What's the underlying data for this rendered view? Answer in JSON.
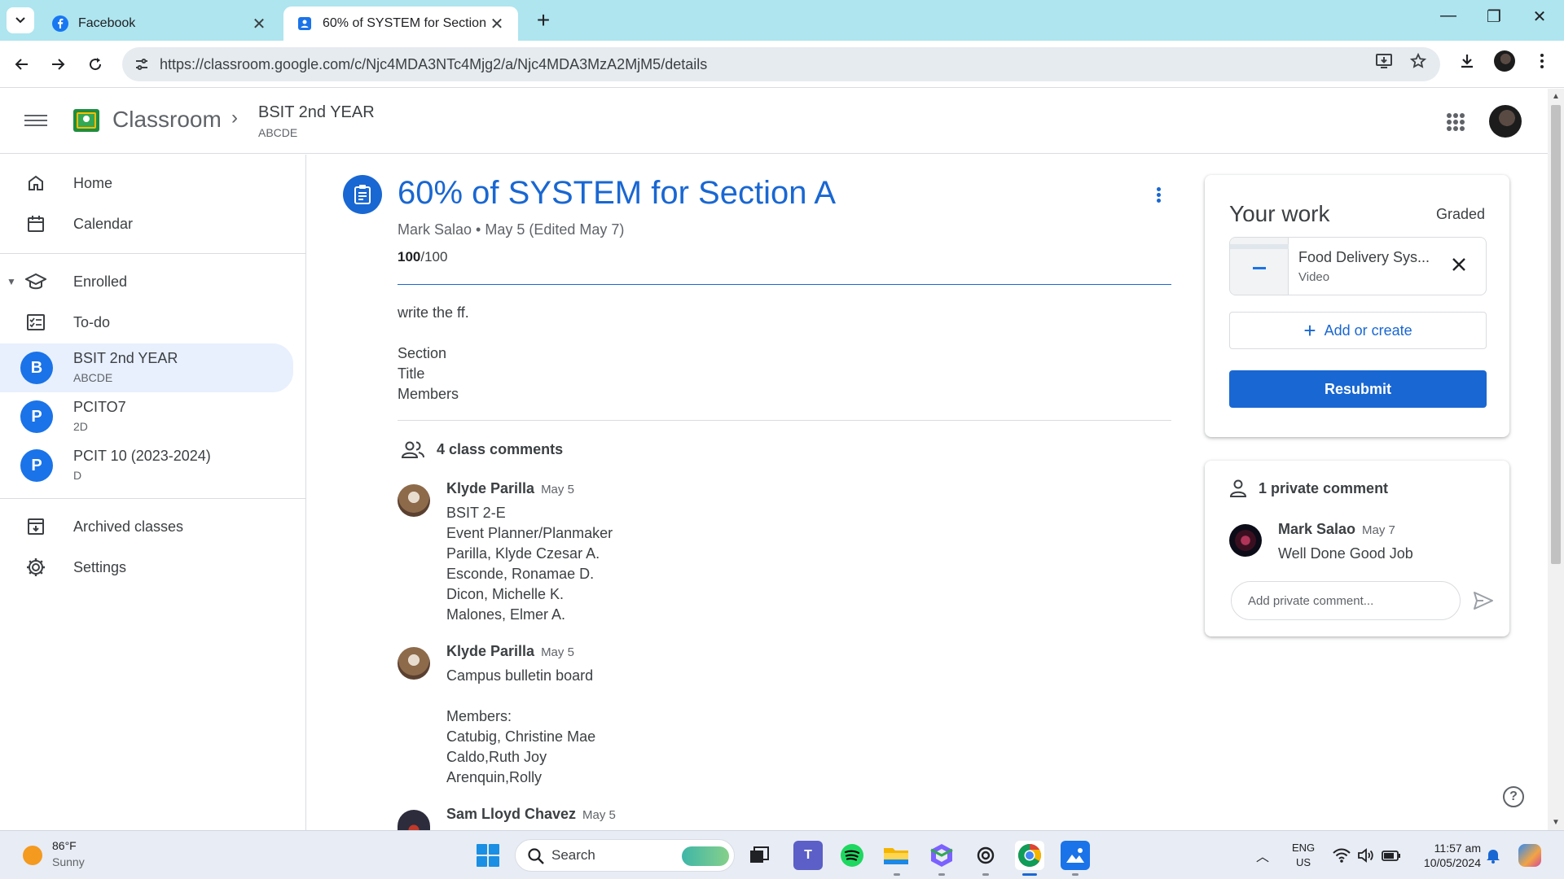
{
  "browser": {
    "tabs": [
      {
        "title": "Facebook",
        "icon": "facebook-icon"
      },
      {
        "title": "60% of SYSTEM for Section A",
        "icon": "classroom-assignment-icon"
      }
    ],
    "url": "https://classroom.google.com/c/Njc4MDA3NTc4Mjg2/a/Njc4MDA3MzA2MjM5/details"
  },
  "header": {
    "app_name": "Classroom",
    "class_name": "BSIT 2nd YEAR",
    "class_section": "ABCDE"
  },
  "sidebar": {
    "home": "Home",
    "calendar": "Calendar",
    "enrolled": "Enrolled",
    "todo": "To-do",
    "courses": [
      {
        "initial": "B",
        "name": "BSIT 2nd YEAR",
        "section": "ABCDE"
      },
      {
        "initial": "P",
        "name": "PCITO7",
        "section": "2D"
      },
      {
        "initial": "P",
        "name": "PCIT 10 (2023-2024)",
        "section": "D"
      }
    ],
    "archived": "Archived classes",
    "settings": "Settings"
  },
  "assignment": {
    "title": "60% of SYSTEM for Section A",
    "meta": "Mark Salao • May 5 (Edited May 7)",
    "score": "100",
    "score_total": "/100",
    "description": [
      "write the ff.",
      "Section",
      "Title",
      "Members"
    ]
  },
  "comments": {
    "header": "4 class comments",
    "items": [
      {
        "author": "Klyde Parilla",
        "date": "May 5",
        "lines": [
          "BSIT 2-E",
          "Event Planner/Planmaker",
          "Parilla, Klyde Czesar A.",
          "Esconde, Ronamae D.",
          "Dicon, Michelle K.",
          "Malones, Elmer  A."
        ]
      },
      {
        "author": "Klyde Parilla",
        "date": "May 5",
        "lines": [
          "Campus bulletin board",
          "",
          "Members:",
          "Catubig, Christine Mae",
          "Caldo,Ruth Joy",
          "Arenquin,Rolly"
        ]
      },
      {
        "author": "Sam Lloyd Chavez",
        "date": "May 5",
        "lines": []
      }
    ]
  },
  "your_work": {
    "title": "Your work",
    "status": "Graded",
    "attachment_name": "Food Delivery Sys...",
    "attachment_type": "Video",
    "add_label": "Add or create",
    "resubmit_label": "Resubmit"
  },
  "private_comments": {
    "header": "1 private comment",
    "author": "Mark Salao",
    "date": "May 7",
    "text": "Well Done Good Job",
    "placeholder": "Add private comment..."
  },
  "taskbar": {
    "weather_temp": "86°F",
    "weather_desc": "Sunny",
    "search_label": "Search",
    "lang_1": "ENG",
    "lang_2": "US",
    "time": "11:57 am",
    "date": "10/05/2024"
  },
  "colors": {
    "accent": "#1967d2",
    "tabstrip": "#aee5ef",
    "selected_nav": "#e8f0fe"
  }
}
